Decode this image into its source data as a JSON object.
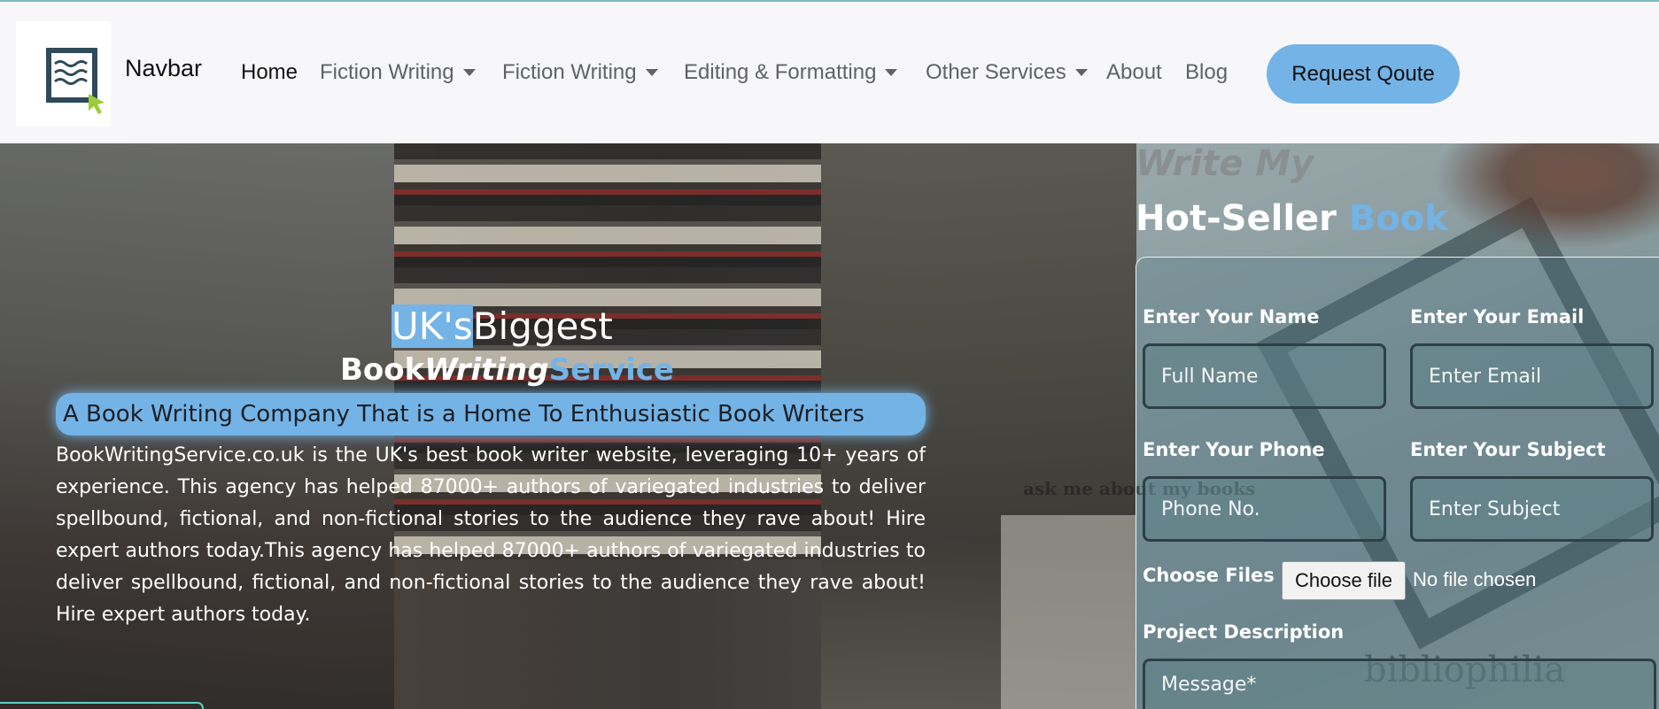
{
  "navbar": {
    "brand": "Navbar",
    "logo_icon": "document-cursor-icon",
    "items": [
      {
        "label": "Home",
        "active": true,
        "dropdown": false
      },
      {
        "label": "Fiction Writing",
        "active": false,
        "dropdown": true
      },
      {
        "label": "Fiction Writing",
        "active": false,
        "dropdown": true
      },
      {
        "label": "Editing & Formatting",
        "active": false,
        "dropdown": true
      },
      {
        "label": "Other Services",
        "active": false,
        "dropdown": true
      },
      {
        "label": "About",
        "active": false,
        "dropdown": false
      },
      {
        "label": "Blog",
        "active": false,
        "dropdown": false
      }
    ],
    "cta": "Request Qoute"
  },
  "hero": {
    "title_highlight": "UK's",
    "title_rest": "Biggest",
    "subtitle_part1": "Book",
    "subtitle_part2": "Writing",
    "subtitle_part3": "Service",
    "tagline": "A Book Writing Company That is a Home To Enthusiastic Book Writers",
    "paragraph": "BookWritingService.co.uk is the UK's best book writer website, leveraging 10+ years of experience. This agency has helped 87000+ authors of variegated industries to deliver spellbound, fictional, and non-fictional stories to the audience they rave about! Hire expert authors today.This agency has helped 87000+ authors of variegated industries to deliver spellbound, fictional, and non-fictional stories to the audience they rave about! Hire expert authors today."
  },
  "background_text": {
    "ask": "ask me about my books",
    "biblio": "bibliophilia"
  },
  "form": {
    "heading_line1": "Write My",
    "heading_line2_white": "Hot-Seller ",
    "heading_line2_blue": "Book",
    "name_label": "Enter Your Name",
    "name_placeholder": "Full Name",
    "email_label": "Enter Your Email",
    "email_placeholder": "Enter Email",
    "phone_label": "Enter Your Phone",
    "phone_placeholder": "Phone No.",
    "subject_label": "Enter Your Subject",
    "subject_placeholder": "Enter Subject",
    "files_label": "Choose Files",
    "file_button": "Choose file",
    "file_status": "No file chosen",
    "description_label": "Project Description",
    "message_placeholder": "Message*"
  },
  "colors": {
    "accent": "#74b3e6",
    "navbar_bg": "#f7f7f9"
  }
}
